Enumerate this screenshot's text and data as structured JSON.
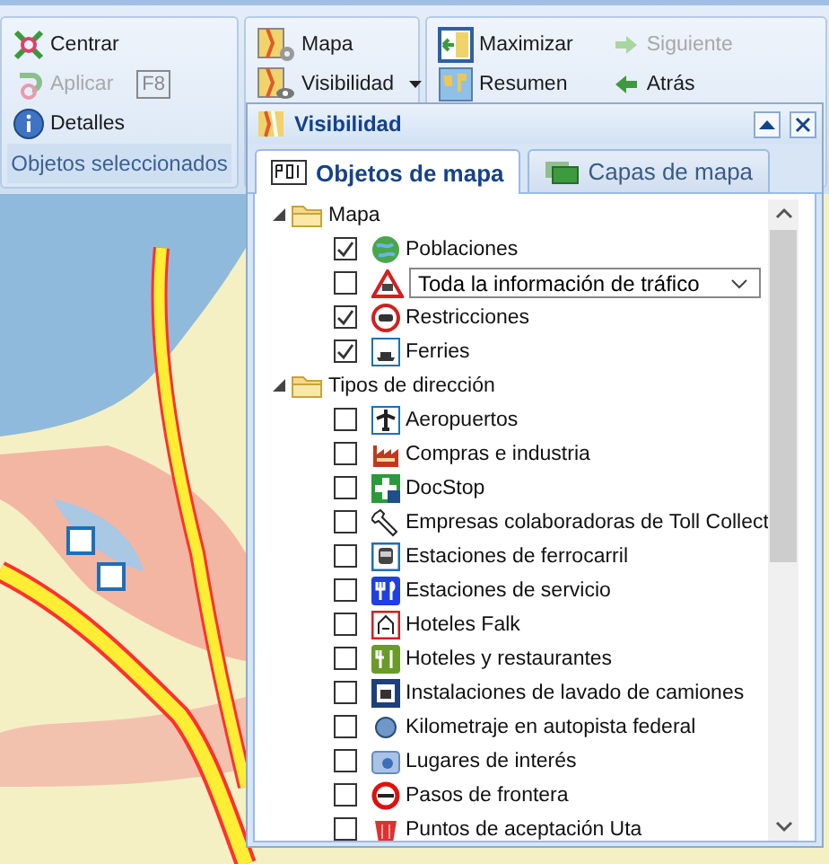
{
  "ribbon": {
    "groups": [
      {
        "footer": "Objetos seleccionados",
        "buttons": [
          {
            "label": "Centrar",
            "disabled": false
          },
          {
            "label": "Aplicar",
            "disabled": true,
            "shortcut": "F8"
          },
          {
            "label": "Detalles",
            "disabled": false
          }
        ]
      },
      {
        "buttons": [
          {
            "label": "Mapa",
            "disabled": false
          },
          {
            "label": "Visibilidad",
            "disabled": false,
            "dropdown": true
          }
        ]
      },
      {
        "buttons": [
          {
            "label": "Maximizar",
            "disabled": false
          },
          {
            "label": "Resumen",
            "disabled": false
          },
          {
            "label": "Siguiente",
            "disabled": true
          },
          {
            "label": "Atrás",
            "disabled": false
          }
        ]
      }
    ]
  },
  "panel": {
    "title": "Visibilidad",
    "tabs": [
      {
        "label": "Objetos de mapa",
        "selected": true
      },
      {
        "label": "Capas de mapa",
        "selected": false
      }
    ],
    "tree": [
      {
        "label": "Mapa",
        "expanded": true,
        "children": [
          {
            "kind": "check",
            "label": "Poblaciones",
            "checked": true
          },
          {
            "kind": "dropdown",
            "value": "Toda la información de tráfico",
            "checked": false
          },
          {
            "kind": "check",
            "label": "Restricciones",
            "checked": true
          },
          {
            "kind": "check",
            "label": "Ferries",
            "checked": true
          }
        ]
      },
      {
        "label": "Tipos de dirección",
        "expanded": true,
        "children": [
          {
            "kind": "check",
            "label": "Aeropuertos",
            "checked": false
          },
          {
            "kind": "check",
            "label": "Compras e industria",
            "checked": false
          },
          {
            "kind": "check",
            "label": "DocStop",
            "checked": false
          },
          {
            "kind": "check",
            "label": "Empresas colaboradoras de Toll Collect",
            "checked": false
          },
          {
            "kind": "check",
            "label": "Estaciones de ferrocarril",
            "checked": false
          },
          {
            "kind": "check",
            "label": "Estaciones de servicio",
            "checked": false
          },
          {
            "kind": "check",
            "label": "Hoteles Falk",
            "checked": false
          },
          {
            "kind": "check",
            "label": "Hoteles y restaurantes",
            "checked": false
          },
          {
            "kind": "check",
            "label": "Instalaciones de lavado de camiones",
            "checked": false
          },
          {
            "kind": "check",
            "label": "Kilometraje en autopista federal",
            "checked": false
          },
          {
            "kind": "check",
            "label": "Lugares de interés",
            "checked": false
          },
          {
            "kind": "check",
            "label": "Pasos de frontera",
            "checked": false
          },
          {
            "kind": "check",
            "label": "Puntos de aceptación Uta",
            "checked": false
          }
        ]
      }
    ]
  }
}
